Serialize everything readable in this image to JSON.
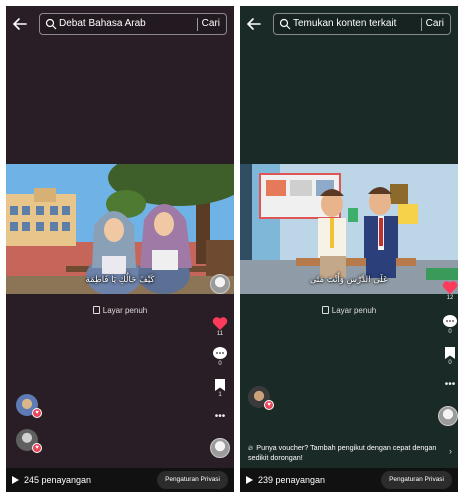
{
  "left": {
    "search_query": "Debat Bahasa Arab",
    "search_button": "Cari",
    "subtitle": "كَيْفَ حَالُكِ يَا فَاطِمَة",
    "fullscreen_label": "Layar penuh",
    "like_count": "11",
    "comment_count": "0",
    "save_count": "1",
    "views": "245 penayangan",
    "privacy_button": "Pengaturan Privasi"
  },
  "right": {
    "search_placeholder": "Temukan konten terkait",
    "search_button": "Cari",
    "subtitle": "عَلَى الدَّرْسِ وَأَنْتَ مَتَى",
    "fullscreen_label": "Layar penuh",
    "like_count": "12",
    "comment_count": "0",
    "save_count": "0",
    "promo_text": "Punya voucher? Tambah pengikut dengan cepat dengan sedikit dorongan!",
    "views": "239 penayangan",
    "privacy_button": "Pengaturan Privasi"
  },
  "colors": {
    "left_bg": "#2a1e26",
    "right_bg": "#1a2a27",
    "like_red": "#ff3b5c"
  },
  "icons": [
    "back-arrow-icon",
    "search-icon",
    "heart-icon",
    "comment-icon",
    "bookmark-icon",
    "more-icon",
    "play-icon",
    "fullscreen-icon",
    "fire-icon",
    "chevron-right-icon"
  ]
}
